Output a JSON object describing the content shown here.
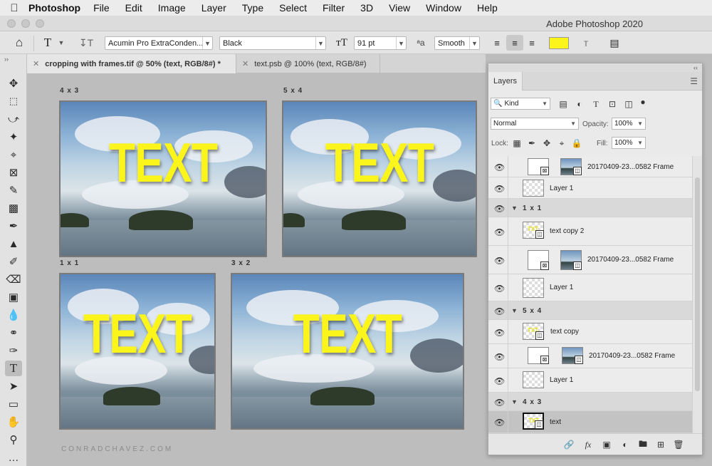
{
  "menubar": {
    "app_name": "Photoshop",
    "items": [
      "File",
      "Edit",
      "Image",
      "Layer",
      "Type",
      "Select",
      "Filter",
      "3D",
      "View",
      "Window",
      "Help"
    ]
  },
  "window": {
    "title": "Adobe Photoshop 2020"
  },
  "options_bar": {
    "font_family": "Acumin Pro ExtraConden...",
    "font_style": "Black",
    "font_size": "91 pt",
    "antialias": "Smooth",
    "text_color": "#fbf51c"
  },
  "doc_tabs": [
    {
      "label": "cropping with frames.tif @ 50% (text, RGB/8#) *",
      "active": true
    },
    {
      "label": "text.psb @ 100% (text, RGB/8#)",
      "active": false
    }
  ],
  "canvas": {
    "watermark": "CONRADCHAVEZ.COM",
    "frames": [
      {
        "label": "4 x 3",
        "text": "TEXT"
      },
      {
        "label": "5 x 4",
        "text": "TEXT"
      },
      {
        "label": "1 x 1",
        "text": "TEXT"
      },
      {
        "label": "3 x 2",
        "text": "TEXT"
      }
    ]
  },
  "layers_panel": {
    "tab": "Layers",
    "filter_kind": "Kind",
    "blend_mode": "Normal",
    "opacity_label": "Opacity:",
    "opacity": "100%",
    "lock_label": "Lock:",
    "fill_label": "Fill:",
    "fill": "100%",
    "layers": [
      {
        "kind": "frame",
        "name": "20170409-23...0582 Frame"
      },
      {
        "kind": "pixel",
        "name": "Layer 1"
      },
      {
        "kind": "group",
        "name": "1 x 1"
      },
      {
        "kind": "smart",
        "name": "text copy 2"
      },
      {
        "kind": "frame",
        "name": "20170409-23...0582 Frame"
      },
      {
        "kind": "pixel",
        "name": "Layer 1"
      },
      {
        "kind": "group",
        "name": "5 x 4"
      },
      {
        "kind": "smart",
        "name": "text copy"
      },
      {
        "kind": "frame",
        "name": "20170409-23...0582 Frame"
      },
      {
        "kind": "pixel",
        "name": "Layer 1"
      },
      {
        "kind": "group",
        "name": "4 x 3"
      },
      {
        "kind": "smart",
        "name": "text",
        "selected": true
      }
    ]
  },
  "icons": {
    "eye": "eye-icon",
    "link": "link-layers-icon",
    "fx": "fx",
    "mask": "add-mask-icon",
    "adjustment": "adjustment-layer-icon",
    "folder": "new-group-icon",
    "new": "new-layer-icon",
    "trash": "trash-icon"
  }
}
